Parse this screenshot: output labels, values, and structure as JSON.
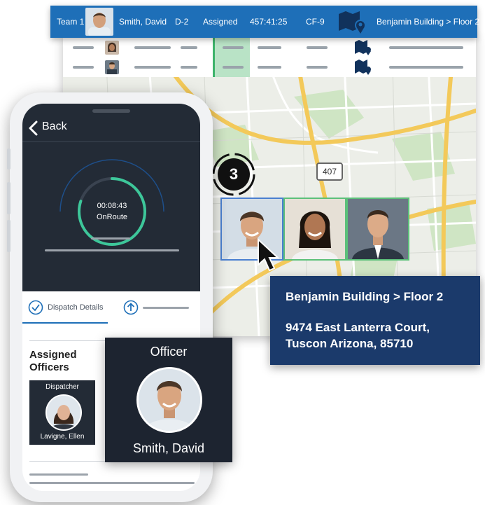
{
  "dispatch_row": {
    "team": "Team 1",
    "officer_name": "Smith, David",
    "unit": "D-2",
    "status": "Assigned",
    "elapsed": "457:41:25",
    "code": "CF-9",
    "location": "Benjamin Building > Floor 2"
  },
  "map": {
    "cluster_count": "3",
    "highway_shield": "407"
  },
  "address_card": {
    "title": "Benjamin Building > Floor 2",
    "line1": "9474 East Lanterra Court,",
    "line2": "Tuscon Arizona, 85710"
  },
  "phone": {
    "back_label": "Back",
    "timer_value": "00:08:43",
    "timer_status": "OnRoute",
    "timer_progress": 0.8,
    "tab_dispatch_label": "Dispatch Details",
    "assigned_title": "Assigned Officers",
    "dispatcher": {
      "role": "Dispatcher",
      "name": "Lavigne, Ellen"
    }
  },
  "officer_card": {
    "role": "Officer",
    "name": "Smith, David"
  },
  "colors": {
    "header_blue": "#1e6fb8",
    "navy_card": "#1b3a6b",
    "dark_panel": "#232b36",
    "accent_green": "#3db36b",
    "selected_blue": "#4a7fd0"
  },
  "icons": [
    "map-pin-icon",
    "chevron-left-icon",
    "check-circle-icon",
    "upload-arrow-icon",
    "pointer-cursor-icon"
  ]
}
